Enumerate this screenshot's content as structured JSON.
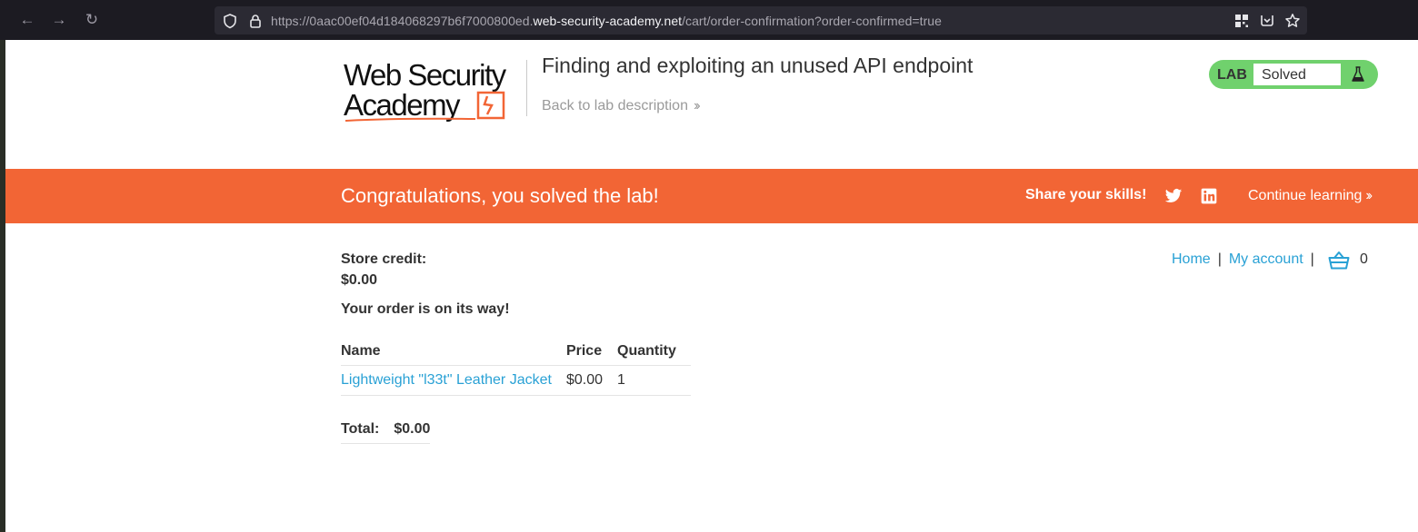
{
  "browser": {
    "url_prefix": "https://0aac00ef04d184068297b6f7000800ed.",
    "url_domain": "web-security-academy.net",
    "url_path": "/cart/order-confirmation?order-confirmed=true"
  },
  "header": {
    "logo_line1": "Web Security",
    "logo_line2": "Academy",
    "lab_title": "Finding and exploiting an unused API endpoint",
    "back_link": "Back to lab description",
    "lab_tag": "LAB",
    "lab_state": "Solved",
    "colors": {
      "solved_green": "#70d16d",
      "accent_orange": "#f26535",
      "link_blue": "#29a1d5"
    }
  },
  "banner": {
    "message": "Congratulations, you solved the lab!",
    "share_label": "Share your skills!",
    "continue_label": "Continue learning"
  },
  "account": {
    "credit_label": "Store credit:",
    "credit_value": "$0.00",
    "order_message": "Your order is on its way!"
  },
  "nav": {
    "home": "Home",
    "separator": "|",
    "my_account": "My account",
    "cart_count": "0"
  },
  "order": {
    "headers": [
      "Name",
      "Price",
      "Quantity"
    ],
    "rows": [
      {
        "name": "Lightweight \"l33t\" Leather Jacket",
        "price": "$0.00",
        "quantity": "1"
      }
    ],
    "total_label": "Total:",
    "total_value": "$0.00"
  }
}
